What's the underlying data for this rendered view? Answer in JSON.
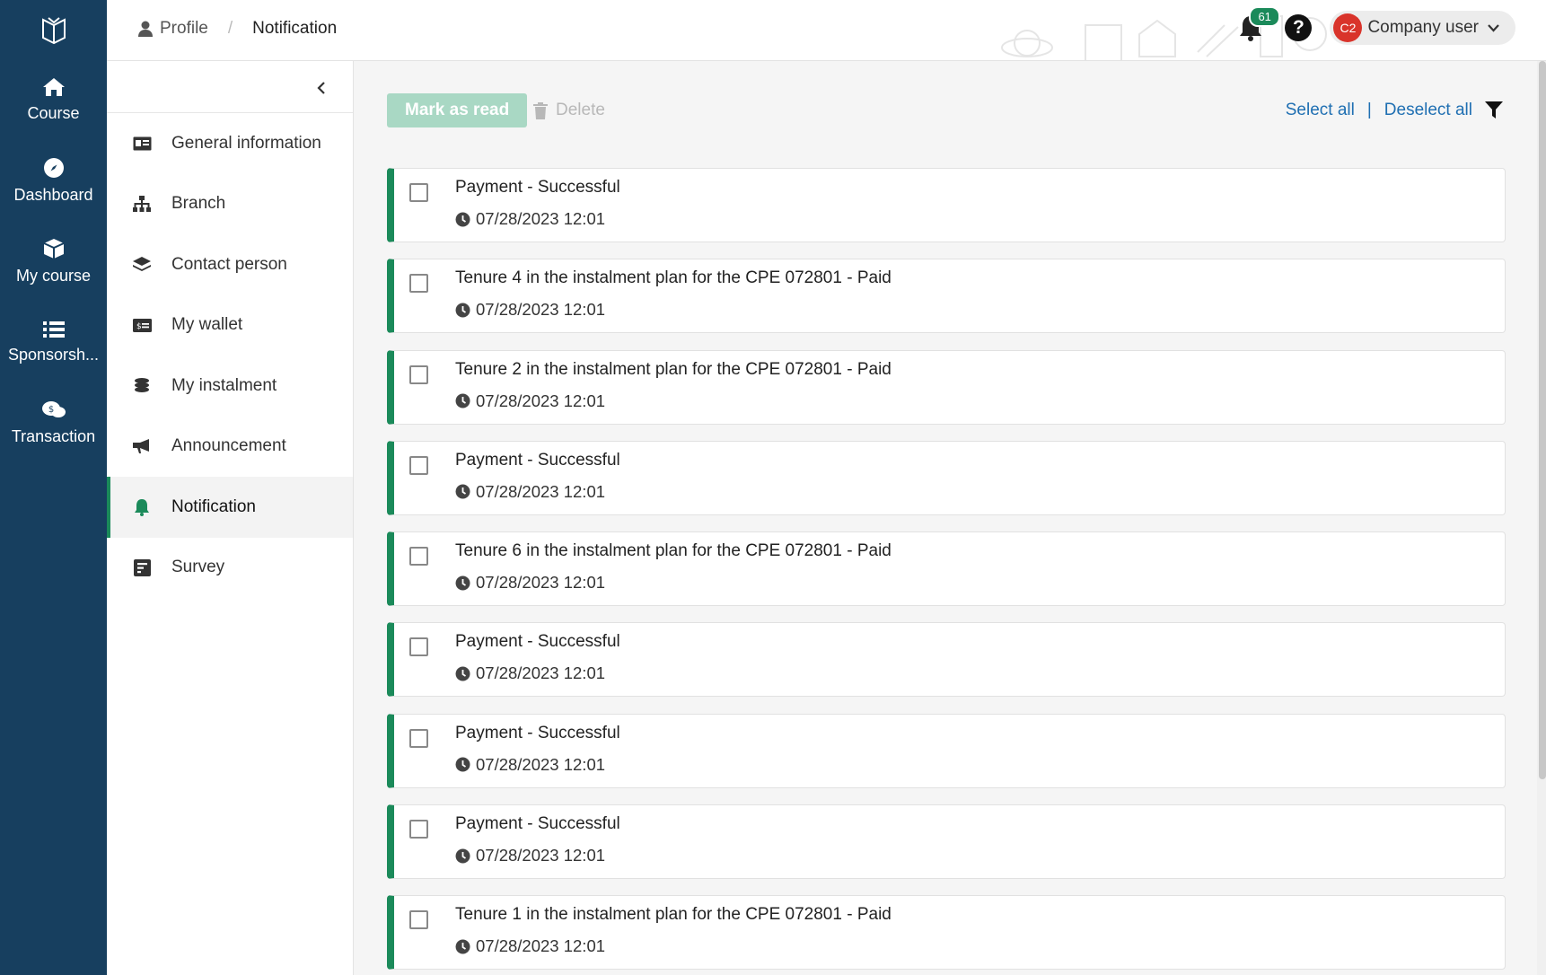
{
  "rail": {
    "items": [
      {
        "label": "Course",
        "icon": "home-icon"
      },
      {
        "label": "Dashboard",
        "icon": "compass-icon"
      },
      {
        "label": "My course",
        "icon": "box-icon"
      },
      {
        "label": "Sponsorsh...",
        "icon": "list-icon"
      },
      {
        "label": "Transaction",
        "icon": "chat-money-icon"
      }
    ]
  },
  "header": {
    "breadcrumb": {
      "profile": "Profile",
      "separator": "/",
      "current": "Notification"
    },
    "notification_count": "61",
    "help_label": "?",
    "user": {
      "initials": "C2",
      "name": "Company user"
    }
  },
  "sidebar": {
    "items": [
      {
        "label": "General information",
        "icon": "id-card-icon",
        "active": false
      },
      {
        "label": "Branch",
        "icon": "sitemap-icon",
        "active": false
      },
      {
        "label": "Contact person",
        "icon": "layers-icon",
        "active": false
      },
      {
        "label": "My wallet",
        "icon": "wallet-icon",
        "active": false
      },
      {
        "label": "My instalment",
        "icon": "coins-icon",
        "active": false
      },
      {
        "label": "Announcement",
        "icon": "megaphone-icon",
        "active": false
      },
      {
        "label": "Notification",
        "icon": "bell-icon",
        "active": true
      },
      {
        "label": "Survey",
        "icon": "survey-icon",
        "active": false
      }
    ]
  },
  "toolbar": {
    "mark_as_read": "Mark as read",
    "delete": "Delete",
    "select_all": "Select all",
    "separator": "|",
    "deselect_all": "Deselect all"
  },
  "notifications": [
    {
      "title": "Payment - Successful",
      "time": "07/28/2023 12:01"
    },
    {
      "title": "Tenure 4 in the instalment plan for the CPE 072801 - Paid",
      "time": "07/28/2023 12:01"
    },
    {
      "title": "Tenure 2 in the instalment plan for the CPE 072801 - Paid",
      "time": "07/28/2023 12:01"
    },
    {
      "title": "Payment - Successful",
      "time": "07/28/2023 12:01"
    },
    {
      "title": "Tenure 6 in the instalment plan for the CPE 072801 - Paid",
      "time": "07/28/2023 12:01"
    },
    {
      "title": "Payment - Successful",
      "time": "07/28/2023 12:01"
    },
    {
      "title": "Payment - Successful",
      "time": "07/28/2023 12:01"
    },
    {
      "title": "Payment - Successful",
      "time": "07/28/2023 12:01"
    },
    {
      "title": "Tenure 1 in the instalment plan for the CPE 072801 - Paid",
      "time": "07/28/2023 12:01"
    }
  ],
  "colors": {
    "rail_bg": "#173f5f",
    "accent_green": "#1b8a5a",
    "link_blue": "#1f6fb2",
    "avatar_red": "#d9342b"
  }
}
